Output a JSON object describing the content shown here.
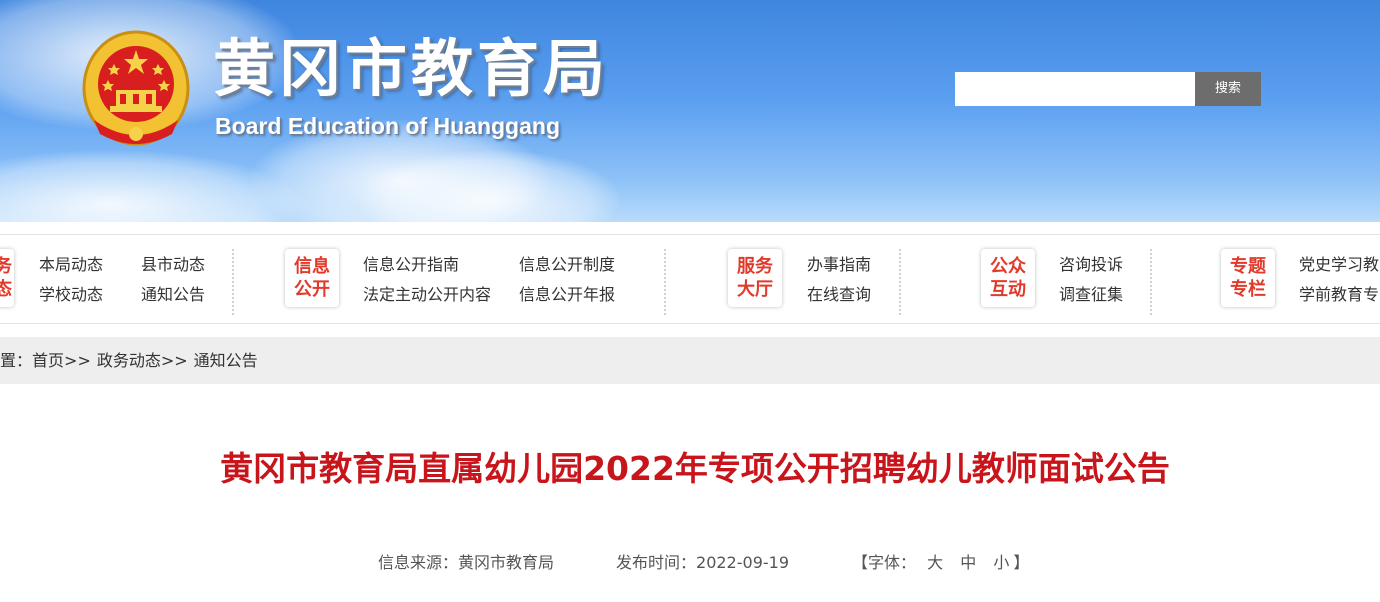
{
  "header": {
    "title": "黄冈市教育局",
    "subtitle": "Board Education of Huanggang",
    "emblem_icon": "national-emblem-icon",
    "search": {
      "value": "",
      "placeholder": "",
      "button_label": "搜索"
    }
  },
  "nav": {
    "group1": {
      "badge_line1": "务",
      "badge_line2": "态",
      "links": [
        "本局动态",
        "县市动态",
        "学校动态",
        "通知公告"
      ]
    },
    "group2": {
      "badge_line1": "信息",
      "badge_line2": "公开",
      "links": [
        "信息公开指南",
        "信息公开制度",
        "法定主动公开内容",
        "信息公开年报"
      ]
    },
    "group3": {
      "badge_line1": "服务",
      "badge_line2": "大厅",
      "links": [
        "办事指南",
        "在线查询"
      ]
    },
    "group4": {
      "badge_line1": "公众",
      "badge_line2": "互动",
      "links": [
        "咨询投诉",
        "调查征集"
      ]
    },
    "group5": {
      "badge_line1": "专题",
      "badge_line2": "专栏",
      "links": [
        "党史学习教",
        "学前教育专"
      ]
    }
  },
  "breadcrumb": {
    "prefix": "位置：",
    "items": [
      "首页",
      "政务动态",
      "通知公告"
    ],
    "separator": ">>"
  },
  "article": {
    "title": "黄冈市教育局直属幼儿园2022年专项公开招聘幼儿教师面试公告",
    "source_label": "信息来源：",
    "source": "黄冈市教育局",
    "date_label": "发布时间：",
    "date": "2022-09-19",
    "font_open": "【字体：",
    "font_large": "大",
    "font_medium": "中",
    "font_small": "小",
    "font_close": "】"
  },
  "colors": {
    "accent_red": "#c8151b",
    "badge_red": "#e23a2a",
    "search_button": "#6d6d6d"
  }
}
